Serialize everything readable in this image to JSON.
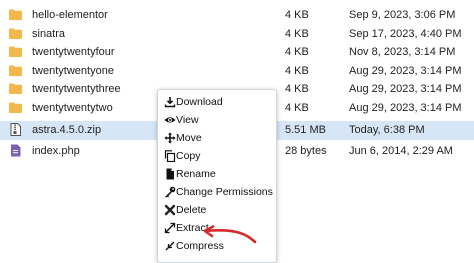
{
  "files": [
    {
      "name": "hello-elementor",
      "size": "4 KB",
      "modified": "Sep 9, 2023, 3:06 PM",
      "type": "folder"
    },
    {
      "name": "sinatra",
      "size": "4 KB",
      "modified": "Sep 17, 2023, 4:40 PM",
      "type": "folder"
    },
    {
      "name": "twentytwentyfour",
      "size": "4 KB",
      "modified": "Nov 8, 2023, 3:14 PM",
      "type": "folder"
    },
    {
      "name": "twentytwentyone",
      "size": "4 KB",
      "modified": "Aug 29, 2023, 3:14 PM",
      "type": "folder"
    },
    {
      "name": "twentytwentythree",
      "size": "4 KB",
      "modified": "Aug 29, 2023, 3:14 PM",
      "type": "folder"
    },
    {
      "name": "twentytwentytwo",
      "size": "4 KB",
      "modified": "Aug 29, 2023, 3:14 PM",
      "type": "folder"
    },
    {
      "name": "astra.4.5.0.zip",
      "size": "5.51 MB",
      "modified": "Today, 6:38 PM",
      "type": "zip"
    },
    {
      "name": "index.php",
      "size": "28 bytes",
      "modified": "Jun 6, 2014, 2:29 AM",
      "type": "php"
    }
  ],
  "context_menu": {
    "download": "Download",
    "view": "View",
    "move": "Move",
    "copy": "Copy",
    "rename": "Rename",
    "change_permissions": "Change Permissions",
    "delete": "Delete",
    "extract": "Extract",
    "compress": "Compress"
  },
  "colors": {
    "folder": "#f2b84b",
    "selected_row": "#d6e6f6",
    "php_icon": "#7b5fb1",
    "annotation": "#d62b2b",
    "delete_icon": "#222222"
  }
}
